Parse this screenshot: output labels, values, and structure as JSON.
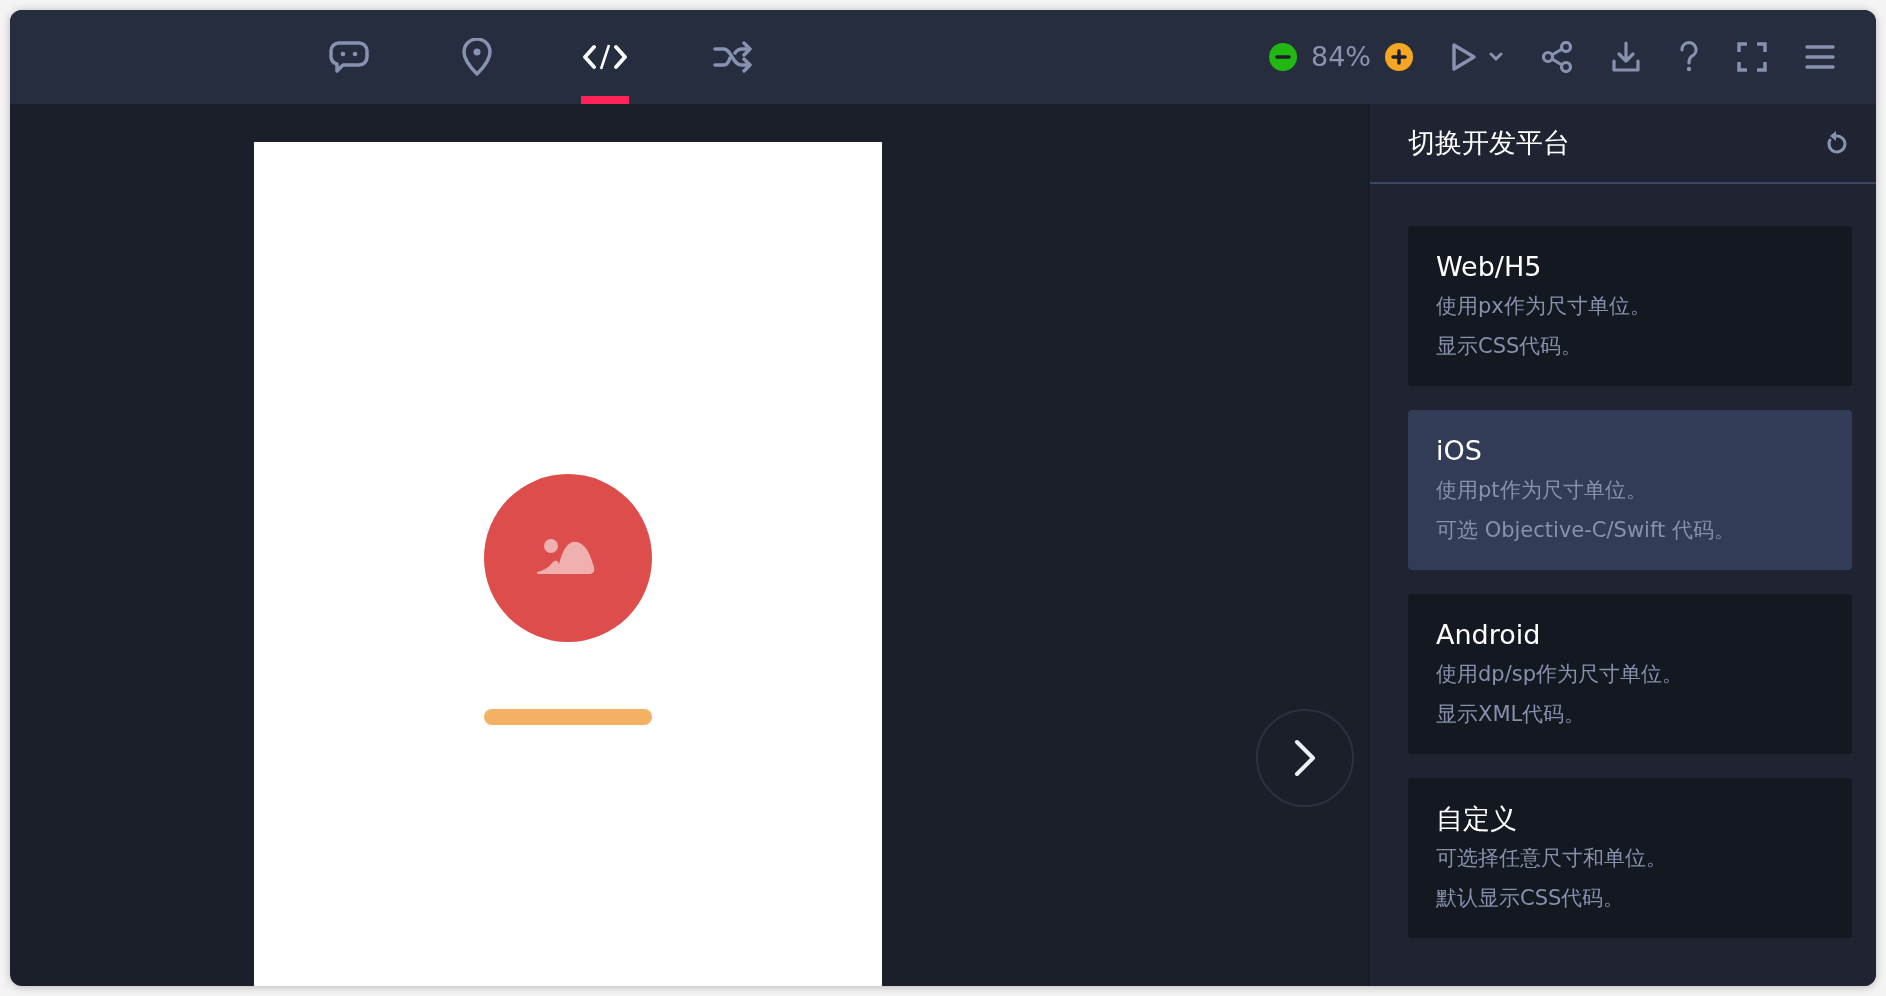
{
  "toolbar": {
    "tabs": [
      {
        "selected": false
      },
      {
        "selected": false
      },
      {
        "selected": true
      },
      {
        "selected": false
      }
    ],
    "zoom": "84%"
  },
  "panel": {
    "title": "切换开发平台",
    "platforms": [
      {
        "title": "Web/H5",
        "lines": [
          "使用px作为尺寸单位。",
          "显示CSS代码。"
        ],
        "selected": false
      },
      {
        "title": "iOS",
        "lines": [
          "使用pt作为尺寸单位。",
          "可选 Objective-C/Swift 代码。"
        ],
        "selected": true
      },
      {
        "title": "Android",
        "lines": [
          "使用dp/sp作为尺寸单位。",
          "显示XML代码。"
        ],
        "selected": false
      },
      {
        "title": "自定义",
        "lines": [
          "可选择任意尺寸和单位。",
          "默认显示CSS代码。"
        ],
        "selected": false
      }
    ]
  }
}
